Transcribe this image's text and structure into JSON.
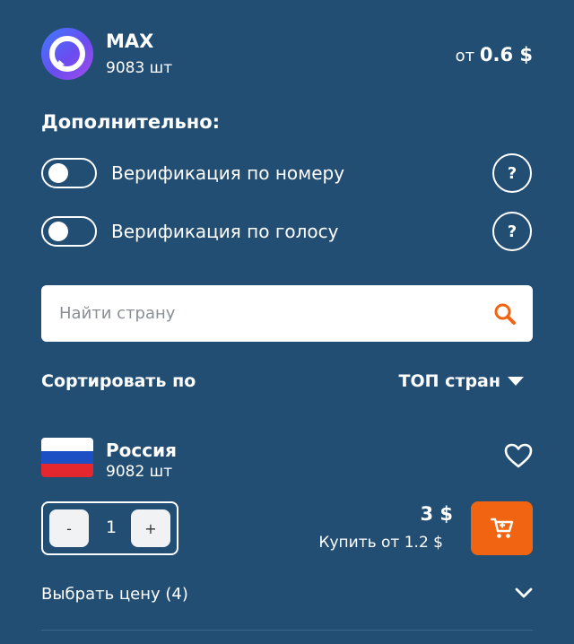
{
  "app": {
    "name": "MAX",
    "count": "9083 шт",
    "price_prefix": "от",
    "price_value": "0.6 $"
  },
  "options": {
    "title": "Дополнительно:",
    "items": [
      {
        "label": "Верификация по номеру",
        "enabled": false,
        "help": "?"
      },
      {
        "label": "Верификация по голосу",
        "enabled": false,
        "help": "?"
      }
    ]
  },
  "search": {
    "placeholder": "Найти страну",
    "value": ""
  },
  "sort": {
    "label": "Сортировать по",
    "value": "ТОП стран"
  },
  "country": {
    "name": "Россия",
    "count": "9082 шт",
    "quantity": "1",
    "minus": "-",
    "plus": "+",
    "price": "3 $",
    "buy_from": "Купить от 1.2 $",
    "flag_colors": [
      "#ffffff",
      "#1c4fc4",
      "#e4262f"
    ]
  },
  "choose_price": "Выбрать цену (4)",
  "colors": {
    "background": "#234e74",
    "accent": "#f16412"
  }
}
